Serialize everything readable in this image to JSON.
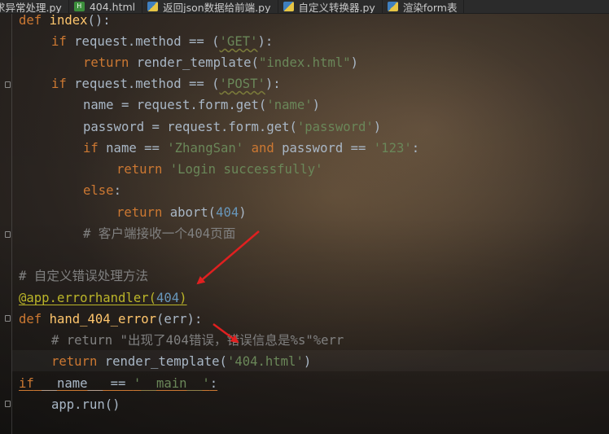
{
  "tabs": [
    {
      "icon": "python-file-icon",
      "label": "求异常处理.py"
    },
    {
      "icon": "html-file-icon",
      "label": "404.html"
    },
    {
      "icon": "python-file-icon",
      "label": "返回json数据给前端.py"
    },
    {
      "icon": "python-file-icon",
      "label": "自定义转换器.py"
    },
    {
      "icon": "python-file-icon",
      "label": "渲染form表"
    }
  ],
  "code": {
    "l1": [
      "def",
      " ",
      "index",
      "():"
    ],
    "l2": [
      "if",
      " request.method == (",
      "'GET'",
      "):"
    ],
    "l3": [
      "return",
      " render_template(",
      "\"index.html\"",
      ")"
    ],
    "l4": [
      "if",
      " request.method == (",
      "'POST'",
      "):"
    ],
    "l5": [
      "name = request.form.get(",
      "'name'",
      ")"
    ],
    "l6": [
      "password = request.form.get(",
      "'password'",
      ")"
    ],
    "l7": [
      "if",
      " name == ",
      "'ZhangSan'",
      " ",
      "and",
      " password == ",
      "'123'",
      ":"
    ],
    "l8": [
      "return",
      " ",
      "'Login successfully'"
    ],
    "l9": [
      "else",
      ":"
    ],
    "l10": [
      "return",
      " abort(",
      "404",
      ")"
    ],
    "l11": "# 客户端接收一个404页面",
    "l12": "# 自定义错误处理方法",
    "l13": [
      "@app.errorhandler(",
      "404",
      ")"
    ],
    "l14": [
      "def",
      " ",
      "hand_404_error",
      "(err):"
    ],
    "l15": "# return \"出现了404错误，错误信息是%s\"%err",
    "l16": [
      "return",
      " render_template(",
      "'404.html'",
      ")"
    ],
    "l17": [
      "if",
      " __name__ == ",
      "'__main__'",
      ":"
    ],
    "l18": "app.run()"
  },
  "colors": {
    "keyword": "#cc7832",
    "string": "#6a8759",
    "number": "#6897bb",
    "comment": "#808080",
    "decorator": "#bbb529",
    "function": "#ffc66d",
    "text": "#a9b7c6",
    "arrow": "#e02020"
  }
}
